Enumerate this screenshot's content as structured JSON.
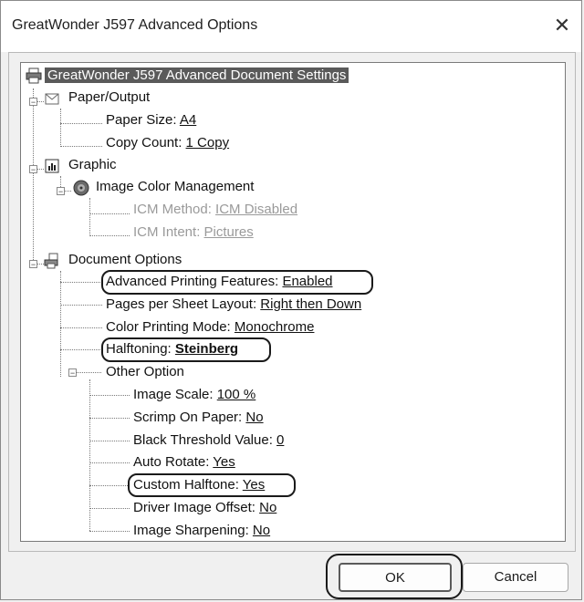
{
  "window": {
    "title": "GreatWonder J597 Advanced Options",
    "close_glyph": "✕"
  },
  "tree": {
    "root": "GreatWonder J597 Advanced Document Settings",
    "paper_output": {
      "label": "Paper/Output",
      "paper_size": {
        "label": "Paper Size: ",
        "value": "A4"
      },
      "copy_count": {
        "label": "Copy Count: ",
        "value": "1 Copy"
      }
    },
    "graphic": {
      "label": "Graphic",
      "icm": {
        "label": "Image Color Management",
        "method": {
          "label": "ICM Method: ",
          "value": "ICM Disabled"
        },
        "intent": {
          "label": "ICM Intent: ",
          "value": "Pictures"
        }
      }
    },
    "document_options": {
      "label": "Document Options",
      "advanced_printing": {
        "label": "Advanced Printing Features: ",
        "value": "Enabled"
      },
      "pages_per_sheet": {
        "label": "Pages per Sheet Layout: ",
        "value": "Right then Down"
      },
      "color_mode": {
        "label": "Color Printing Mode: ",
        "value": "Monochrome"
      },
      "halftoning": {
        "label": "Halftoning: ",
        "value": "Steinberg"
      },
      "other": {
        "label": "Other Option",
        "image_scale": {
          "label": "Image Scale: ",
          "value": "100 %"
        },
        "scrimp": {
          "label": "Scrimp On Paper: ",
          "value": "No"
        },
        "black_threshold": {
          "label": "Black Threshold Value: ",
          "value": "0"
        },
        "auto_rotate": {
          "label": "Auto Rotate: ",
          "value": "Yes"
        },
        "custom_halftone": {
          "label": "Custom Halftone: ",
          "value": "Yes"
        },
        "driver_offset": {
          "label": "Driver Image Offset: ",
          "value": "No"
        },
        "sharpening": {
          "label": "Image Sharpening: ",
          "value": "No"
        }
      }
    },
    "expander_glyph": "−"
  },
  "buttons": {
    "ok": "OK",
    "cancel": "Cancel"
  },
  "icons": {
    "root": "printer-icon",
    "paper_output": "paper-envelope-icon",
    "graphic": "chart-icon",
    "icm": "color-wheel-icon",
    "document_options": "printer-document-icon"
  }
}
